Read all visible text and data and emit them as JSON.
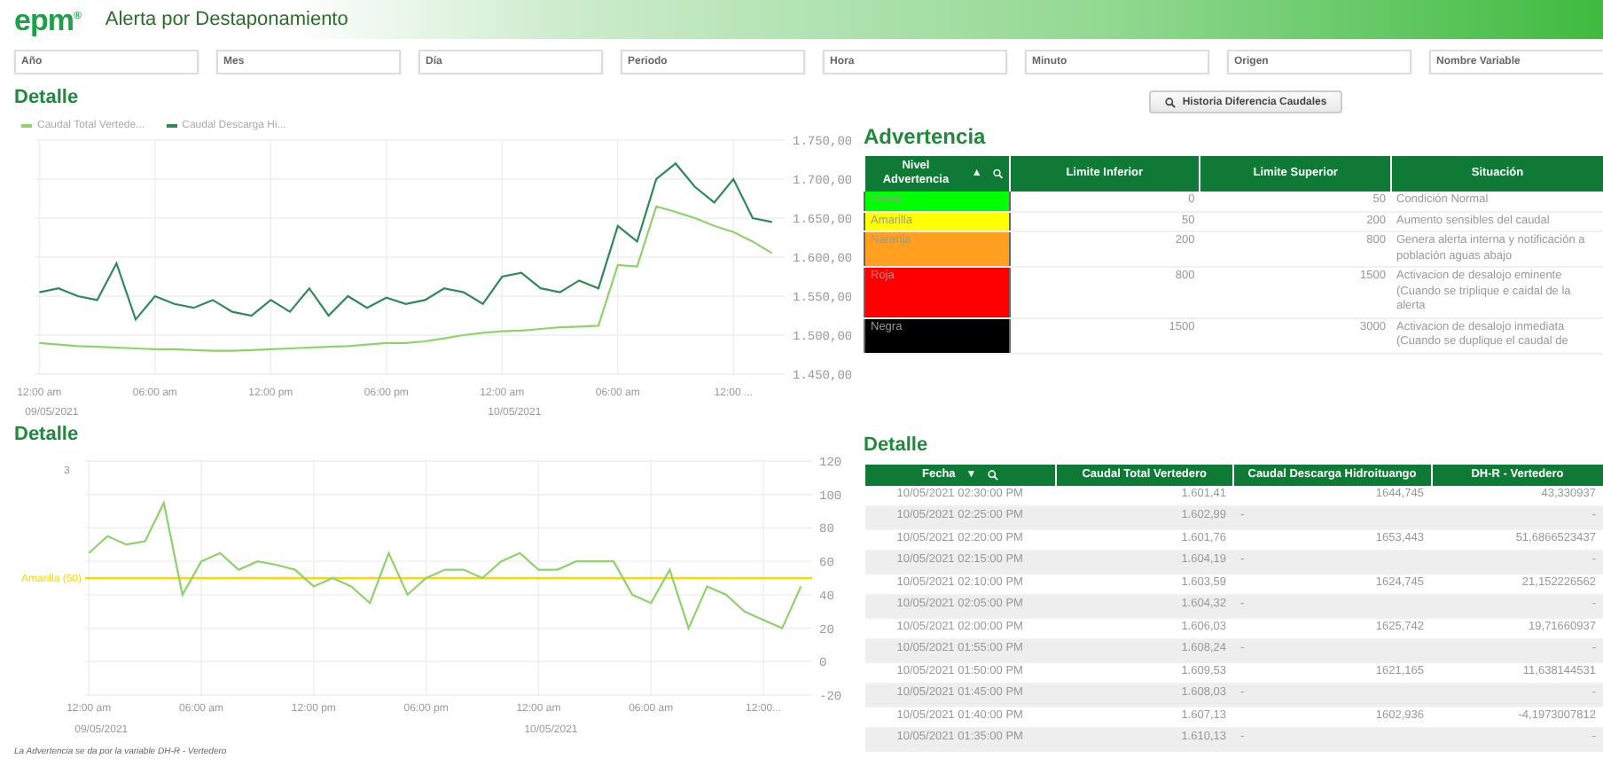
{
  "header": {
    "logo": "epm$^{®}$",
    "title": "Alerta por Destaponamiento"
  },
  "filters": [
    {
      "label": "Año"
    },
    {
      "label": "Mes"
    },
    {
      "label": "Día"
    },
    {
      "label": "Periodo"
    },
    {
      "label": "Hora"
    },
    {
      "label": "Minuto"
    },
    {
      "label": "Origen"
    },
    {
      "label": "Nombre Variable"
    }
  ],
  "chart_panels": [
    {
      "title": "Detalle",
      "chart_data": {
        "type": "line",
        "grid": true,
        "x": [
          "2021-05-09 00:00",
          "2021-05-09 01:00",
          "2021-05-09 02:00",
          "2021-05-09 03:00",
          "2021-05-09 04:00",
          "2021-05-09 05:00",
          "2021-05-09 06:00",
          "2021-05-09 07:00",
          "2021-05-09 08:00",
          "2021-05-09 09:00",
          "2021-05-09 10:00",
          "2021-05-09 11:00",
          "2021-05-09 12:00",
          "2021-05-09 13:00",
          "2021-05-09 14:00",
          "2021-05-09 15:00",
          "2021-05-09 16:00",
          "2021-05-09 17:00",
          "2021-05-09 18:00",
          "2021-05-09 19:00",
          "2021-05-09 20:00",
          "2021-05-09 21:00",
          "2021-05-09 22:00",
          "2021-05-09 23:00",
          "2021-05-10 00:00",
          "2021-05-10 01:00",
          "2021-05-10 02:00",
          "2021-05-10 03:00",
          "2021-05-10 04:00",
          "2021-05-10 05:00",
          "2021-05-10 06:00",
          "2021-05-10 07:00",
          "2021-05-10 08:00",
          "2021-05-10 09:00",
          "2021-05-10 10:00",
          "2021-05-10 11:00",
          "2021-05-10 12:00",
          "2021-05-10 13:00",
          "2021-05-10 14:00"
        ],
        "series": [
          {
            "name": "Caudal Total Vertede...",
            "color": "#8fd16a",
            "values": [
              1490,
              1488,
              1486,
              1485,
              1484,
              1483,
              1482,
              1482,
              1481,
              1480,
              1480,
              1481,
              1482,
              1483,
              1484,
              1485,
              1486,
              1488,
              1490,
              1490,
              1492,
              1496,
              1500,
              1503,
              1505,
              1506,
              1508,
              1510,
              1511,
              1512,
              1590,
              1588,
              1665,
              1658,
              1650,
              1640,
              1632,
              1620,
              1605
            ]
          },
          {
            "name": "Caudal Descarga Hi...",
            "color": "#2e8b57",
            "values": [
              1555,
              1560,
              1550,
              1545,
              1592,
              1520,
              1550,
              1540,
              1535,
              1545,
              1530,
              1525,
              1545,
              1530,
              1560,
              1525,
              1550,
              1535,
              1548,
              1540,
              1545,
              1560,
              1555,
              1540,
              1575,
              1580,
              1560,
              1555,
              1570,
              1560,
              1640,
              1620,
              1700,
              1720,
              1690,
              1670,
              1700,
              1650,
              1645
            ]
          }
        ],
        "xlim": [
          "2021-05-08 23:48",
          "2021-05-10 14:42"
        ],
        "ylim": [
          1450,
          1750
        ],
        "xticks": [
          {
            "value": "2021-05-09 00:00",
            "label": "12:00 am"
          },
          {
            "value": "2021-05-09 06:00",
            "label": "06:00 am"
          },
          {
            "value": "2021-05-09 12:00",
            "label": "12:00 pm"
          },
          {
            "value": "2021-05-09 18:00",
            "label": "06:00 pm"
          },
          {
            "value": "2021-05-10 00:00",
            "label": "12:00 am"
          },
          {
            "value": "2021-05-10 06:00",
            "label": "06:00 am"
          },
          {
            "value": "2021-05-10 12:00",
            "label": "12:00 ..."
          }
        ],
        "yticks": [
          {
            "value": 1450,
            "label": "1.450,00"
          },
          {
            "value": 1500,
            "label": "1.500,00"
          },
          {
            "value": 1550,
            "label": "1.550,00"
          },
          {
            "value": 1600,
            "label": "1.600,00"
          },
          {
            "value": 1650,
            "label": "1.650,00"
          },
          {
            "value": 1700,
            "label": "1.700,00"
          },
          {
            "value": 1750,
            "label": "1.750,00"
          }
        ],
        "annotations": [
          "09/05/2021",
          "10/05/2021"
        ]
      }
    },
    {
      "title": "Detalle",
      "chart_data": {
        "type": "line",
        "grid": true,
        "x": [
          "2021-05-09 00:00",
          "2021-05-09 01:00",
          "2021-05-09 02:00",
          "2021-05-09 03:00",
          "2021-05-09 04:00",
          "2021-05-09 05:00",
          "2021-05-09 06:00",
          "2021-05-09 07:00",
          "2021-05-09 08:00",
          "2021-05-09 09:00",
          "2021-05-09 10:00",
          "2021-05-09 11:00",
          "2021-05-09 12:00",
          "2021-05-09 13:00",
          "2021-05-09 14:00",
          "2021-05-09 15:00",
          "2021-05-09 16:00",
          "2021-05-09 17:00",
          "2021-05-09 18:00",
          "2021-05-09 19:00",
          "2021-05-09 20:00",
          "2021-05-09 21:00",
          "2021-05-09 22:00",
          "2021-05-09 23:00",
          "2021-05-10 00:00",
          "2021-05-10 01:00",
          "2021-05-10 02:00",
          "2021-05-10 03:00",
          "2021-05-10 04:00",
          "2021-05-10 05:00",
          "2021-05-10 06:00",
          "2021-05-10 07:00",
          "2021-05-10 08:00",
          "2021-05-10 09:00",
          "2021-05-10 10:00",
          "2021-05-10 11:00",
          "2021-05-10 12:00",
          "2021-05-10 13:00",
          "2021-05-10 14:00"
        ],
        "series": [
          {
            "color": "#8fd16a",
            "values": [
              65,
              75,
              70,
              72,
              95,
              40,
              60,
              65,
              55,
              60,
              58,
              55,
              45,
              50,
              45,
              35,
              65,
              40,
              50,
              55,
              55,
              50,
              60,
              65,
              55,
              55,
              60,
              60,
              60,
              40,
              35,
              55,
              20,
              45,
              40,
              30,
              25,
              20,
              45
            ]
          }
        ],
        "xlim": [
          "2021-05-08 23:48",
          "2021-05-10 14:36"
        ],
        "ylim": [
          -20,
          120
        ],
        "xticks": [
          {
            "value": "2021-05-09 00:00",
            "label": "12:00 am"
          },
          {
            "value": "2021-05-09 06:00",
            "label": "06:00 am"
          },
          {
            "value": "2021-05-09 12:00",
            "label": "12:00 pm"
          },
          {
            "value": "2021-05-09 18:00",
            "label": "06:00 pm"
          },
          {
            "value": "2021-05-10 00:00",
            "label": "12:00 am"
          },
          {
            "value": "2021-05-10 06:00",
            "label": "06:00 am"
          },
          {
            "value": "2021-05-10 12:00",
            "label": "12:00..."
          }
        ],
        "yticks": [
          -20,
          0,
          20,
          40,
          60,
          80,
          100,
          120
        ],
        "ref_lines": [
          {
            "axis": "y",
            "value": 50,
            "label": "Amarilla (50)",
            "color": "#ffd700"
          }
        ],
        "annotations": [
          "09/05/2021",
          "10/05/2021",
          "3"
        ]
      }
    }
  ],
  "footnote": "La Advertencia se da por la variable DH-R - Vertedero",
  "history_button": {
    "label": "Historia Diferencia Caudales"
  },
  "advertencia": {
    "title": "Advertencia",
    "columns": [
      {
        "label": "Nivel Advertencia",
        "sort_indicator": "▲",
        "searchable": true
      },
      {
        "label": "Limite Inferior"
      },
      {
        "label": "Limite Superior"
      },
      {
        "label": "Situación"
      }
    ],
    "rows": [
      {
        "level": "Verde",
        "color": "#00ff00",
        "lower": "0",
        "upper": "50",
        "situation": "Condición Normal"
      },
      {
        "level": "Amarilla",
        "color": "#ffff00",
        "lower": "50",
        "upper": "200",
        "situation": "Aumento sensibles del caudal"
      },
      {
        "level": "Naranja",
        "color": "#ffa020",
        "lower": "200",
        "upper": "800",
        "situation": "Genera alerta interna y notificación a población aguas abajo"
      },
      {
        "level": "Roja",
        "color": "#ff0000",
        "lower": "800",
        "upper": "1500",
        "situation": "Activacion de desalojo eminente (Cuando se triplique e caidal de la alerta"
      },
      {
        "level": "Negra",
        "color": "#000000",
        "lower": "1500",
        "upper": "3000",
        "situation": "Activacion de desalojo inmediata (Cuando se duplique el caudal de"
      }
    ]
  },
  "detalle_table": {
    "title": "Detalle",
    "columns": [
      {
        "label": "Fecha",
        "sort_indicator": "▼",
        "searchable": true
      },
      {
        "label": "Caudal Total Vertedero"
      },
      {
        "label": "Caudal Descarga Hidroituango"
      },
      {
        "label": "DH-R - Vertedero"
      }
    ],
    "rows": [
      [
        "10/05/2021 02:30:00 PM",
        "1.601,41",
        "1644,745",
        "43,330937"
      ],
      [
        "10/05/2021 02:25:00 PM",
        "1.602,99",
        "-",
        "-"
      ],
      [
        "10/05/2021 02:20:00 PM",
        "1.601,76",
        "1653,443",
        "51,6866523437"
      ],
      [
        "10/05/2021 02:15:00 PM",
        "1.604,19",
        "-",
        "-"
      ],
      [
        "10/05/2021 02:10:00 PM",
        "1.603,59",
        "1624,745",
        "21,152226562"
      ],
      [
        "10/05/2021 02:05:00 PM",
        "1.604,32",
        "-",
        "-"
      ],
      [
        "10/05/2021 02:00:00 PM",
        "1.606,03",
        "1625,742",
        "19,71660937"
      ],
      [
        "10/05/2021 01:55:00 PM",
        "1.608,24",
        "-",
        "-"
      ],
      [
        "10/05/2021 01:50:00 PM",
        "1.609,53",
        "1621,165",
        "11,638144531"
      ],
      [
        "10/05/2021 01:45:00 PM",
        "1.608,03",
        "-",
        "-"
      ],
      [
        "10/05/2021 01:40:00 PM",
        "1.607,13",
        "1602,936",
        "-4,1973007812"
      ],
      [
        "10/05/2021 01:35:00 PM",
        "1.610,13",
        "-",
        "-"
      ]
    ]
  }
}
